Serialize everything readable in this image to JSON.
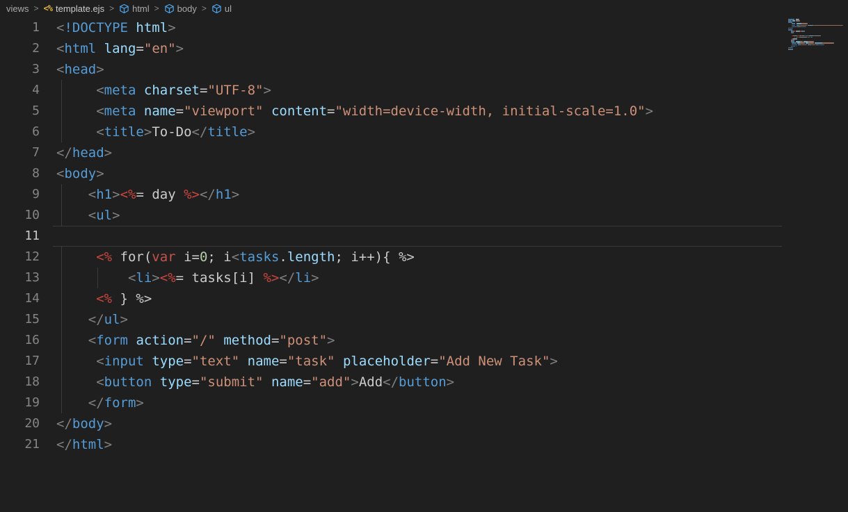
{
  "breadcrumbs": {
    "separator": ">",
    "items": [
      {
        "label": "views",
        "icon": null
      },
      {
        "label": "template.ejs",
        "icon": "ejs-file-icon"
      },
      {
        "label": "html",
        "icon": "cube-symbol-icon"
      },
      {
        "label": "body",
        "icon": "cube-symbol-icon"
      },
      {
        "label": "ul",
        "icon": "cube-symbol-icon"
      }
    ]
  },
  "colors": {
    "background": "#1f1f1f",
    "punctuation": "#808080",
    "tag": "#569CD6",
    "attribute": "#9CDCFE",
    "string": "#CE9178",
    "plain_text": "#cccccc",
    "ejs_delimiter": "#CB463E",
    "keyword_var": "#C5534B",
    "number": "#B5CEA8",
    "line_number": "#858585",
    "line_number_active": "#c8c8c8",
    "indent_guide": "#3b3b3b",
    "current_line_border": "#3a3a3a",
    "ejs_icon": "#E3B341",
    "cube_icon": "#4DA3E8"
  },
  "editor": {
    "active_line": 11,
    "lines": [
      {
        "num": 1,
        "indent": 0,
        "guides": [],
        "tokens": [
          [
            "p",
            "<"
          ],
          [
            "tag",
            "!DOCTYPE"
          ],
          [
            "x",
            " "
          ],
          [
            "attr",
            "html"
          ],
          [
            "p",
            ">"
          ]
        ]
      },
      {
        "num": 2,
        "indent": 0,
        "guides": [],
        "tokens": [
          [
            "p",
            "<"
          ],
          [
            "tag",
            "html"
          ],
          [
            "x",
            " "
          ],
          [
            "attr",
            "lang"
          ],
          [
            "x",
            "="
          ],
          [
            "str",
            "\"en\""
          ],
          [
            "p",
            ">"
          ]
        ]
      },
      {
        "num": 3,
        "indent": 0,
        "guides": [],
        "tokens": [
          [
            "p",
            "<"
          ],
          [
            "tag",
            "head"
          ],
          [
            "p",
            ">"
          ]
        ]
      },
      {
        "num": 4,
        "indent": 5,
        "guides": [
          88
        ],
        "tokens": [
          [
            "p",
            "<"
          ],
          [
            "tag",
            "meta"
          ],
          [
            "x",
            " "
          ],
          [
            "attr",
            "charset"
          ],
          [
            "x",
            "="
          ],
          [
            "str",
            "\"UTF-8\""
          ],
          [
            "p",
            ">"
          ]
        ]
      },
      {
        "num": 5,
        "indent": 5,
        "guides": [
          88
        ],
        "tokens": [
          [
            "p",
            "<"
          ],
          [
            "tag",
            "meta"
          ],
          [
            "x",
            " "
          ],
          [
            "attr",
            "name"
          ],
          [
            "x",
            "="
          ],
          [
            "str",
            "\"viewport\""
          ],
          [
            "x",
            " "
          ],
          [
            "attr",
            "content"
          ],
          [
            "x",
            "="
          ],
          [
            "str",
            "\"width=device-width, initial-scale=1.0\""
          ],
          [
            "p",
            ">"
          ]
        ]
      },
      {
        "num": 6,
        "indent": 5,
        "guides": [
          88
        ],
        "tokens": [
          [
            "p",
            "<"
          ],
          [
            "tag",
            "title"
          ],
          [
            "p",
            ">"
          ],
          [
            "x",
            "To-Do"
          ],
          [
            "p",
            "</"
          ],
          [
            "tag",
            "title"
          ],
          [
            "p",
            ">"
          ]
        ]
      },
      {
        "num": 7,
        "indent": 0,
        "guides": [],
        "tokens": [
          [
            "p",
            "</"
          ],
          [
            "tag",
            "head"
          ],
          [
            "p",
            ">"
          ]
        ]
      },
      {
        "num": 8,
        "indent": 0,
        "guides": [],
        "tokens": [
          [
            "p",
            "<"
          ],
          [
            "tag",
            "body"
          ],
          [
            "p",
            ">"
          ]
        ]
      },
      {
        "num": 9,
        "indent": 4,
        "guides": [
          88
        ],
        "tokens": [
          [
            "p",
            "<"
          ],
          [
            "tag",
            "h1"
          ],
          [
            "p",
            ">"
          ],
          [
            "ejs",
            "<%"
          ],
          [
            "x",
            "= day "
          ],
          [
            "ejs",
            "%>"
          ],
          [
            "p",
            "</"
          ],
          [
            "tag",
            "h1"
          ],
          [
            "p",
            ">"
          ]
        ]
      },
      {
        "num": 10,
        "indent": 4,
        "guides": [
          88
        ],
        "tokens": [
          [
            "p",
            "<"
          ],
          [
            "tag",
            "ul"
          ],
          [
            "p",
            ">"
          ]
        ]
      },
      {
        "num": 11,
        "indent": 0,
        "guides": [],
        "tokens": []
      },
      {
        "num": 12,
        "indent": 5,
        "guides": [
          88
        ],
        "tokens": [
          [
            "ejs",
            "<%"
          ],
          [
            "x",
            " for("
          ],
          [
            "kw",
            "var"
          ],
          [
            "x",
            " i="
          ],
          [
            "num",
            "0"
          ],
          [
            "x",
            "; i"
          ],
          [
            "p",
            "<"
          ],
          [
            "tag",
            "tasks"
          ],
          [
            "x",
            "."
          ],
          [
            "attr",
            "length"
          ],
          [
            "x",
            "; i++){ %>"
          ]
        ]
      },
      {
        "num": 13,
        "indent": 9,
        "guides": [
          88,
          140
        ],
        "tokens": [
          [
            "p",
            "<"
          ],
          [
            "tag",
            "li"
          ],
          [
            "p",
            ">"
          ],
          [
            "ejs",
            "<%"
          ],
          [
            "x",
            "= tasks[i] "
          ],
          [
            "ejs",
            "%>"
          ],
          [
            "p",
            "</"
          ],
          [
            "tag",
            "li"
          ],
          [
            "p",
            ">"
          ]
        ]
      },
      {
        "num": 14,
        "indent": 5,
        "guides": [
          88
        ],
        "tokens": [
          [
            "ejs",
            "<%"
          ],
          [
            "x",
            " } %>"
          ]
        ]
      },
      {
        "num": 15,
        "indent": 4,
        "guides": [
          88
        ],
        "tokens": [
          [
            "p",
            "</"
          ],
          [
            "tag",
            "ul"
          ],
          [
            "p",
            ">"
          ]
        ]
      },
      {
        "num": 16,
        "indent": 4,
        "guides": [
          88
        ],
        "tokens": [
          [
            "p",
            "<"
          ],
          [
            "tag",
            "form"
          ],
          [
            "x",
            " "
          ],
          [
            "attr",
            "action"
          ],
          [
            "x",
            "="
          ],
          [
            "str",
            "\"/\""
          ],
          [
            "x",
            " "
          ],
          [
            "attr",
            "method"
          ],
          [
            "x",
            "="
          ],
          [
            "str",
            "\"post\""
          ],
          [
            "p",
            ">"
          ]
        ]
      },
      {
        "num": 17,
        "indent": 5,
        "guides": [
          88
        ],
        "tokens": [
          [
            "p",
            "<"
          ],
          [
            "tag",
            "input"
          ],
          [
            "x",
            " "
          ],
          [
            "attr",
            "type"
          ],
          [
            "x",
            "="
          ],
          [
            "str",
            "\"text\""
          ],
          [
            "x",
            " "
          ],
          [
            "attr",
            "name"
          ],
          [
            "x",
            "="
          ],
          [
            "str",
            "\"task\""
          ],
          [
            "x",
            " "
          ],
          [
            "attr",
            "placeholder"
          ],
          [
            "x",
            "="
          ],
          [
            "str",
            "\"Add New Task\""
          ],
          [
            "p",
            ">"
          ]
        ]
      },
      {
        "num": 18,
        "indent": 5,
        "guides": [
          88
        ],
        "tokens": [
          [
            "p",
            "<"
          ],
          [
            "tag",
            "button"
          ],
          [
            "x",
            " "
          ],
          [
            "attr",
            "type"
          ],
          [
            "x",
            "="
          ],
          [
            "str",
            "\"submit\""
          ],
          [
            "x",
            " "
          ],
          [
            "attr",
            "name"
          ],
          [
            "x",
            "="
          ],
          [
            "str",
            "\"add\""
          ],
          [
            "p",
            ">"
          ],
          [
            "x",
            "Add"
          ],
          [
            "p",
            "</"
          ],
          [
            "tag",
            "button"
          ],
          [
            "p",
            ">"
          ]
        ]
      },
      {
        "num": 19,
        "indent": 4,
        "guides": [
          88
        ],
        "tokens": [
          [
            "p",
            "</"
          ],
          [
            "tag",
            "form"
          ],
          [
            "p",
            ">"
          ]
        ]
      },
      {
        "num": 20,
        "indent": 0,
        "guides": [],
        "tokens": [
          [
            "p",
            "</"
          ],
          [
            "tag",
            "body"
          ],
          [
            "p",
            ">"
          ]
        ]
      },
      {
        "num": 21,
        "indent": 0,
        "guides": [],
        "tokens": [
          [
            "p",
            "</"
          ],
          [
            "tag",
            "html"
          ],
          [
            "p",
            ">"
          ]
        ]
      }
    ]
  }
}
